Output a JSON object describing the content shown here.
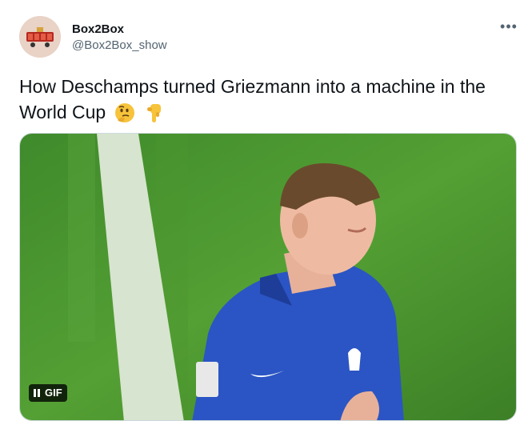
{
  "tweet": {
    "author_name": "Box2Box",
    "handle": "@Box2Box_show",
    "text": "How Deschamps turned Griezmann into a machine in the World Cup",
    "emojis": [
      "thinking-face-icon",
      "backhand-index-pointing-down-icon"
    ],
    "more_icon": "more-options-icon"
  },
  "media": {
    "type": "gif",
    "badge_label": "GIF",
    "pause_icon": "pause-icon"
  },
  "colors": {
    "text": "#0f1419",
    "secondary_text": "#536471",
    "pitch_green": "#4a8f2d",
    "jersey_blue": "#2b55c4"
  }
}
